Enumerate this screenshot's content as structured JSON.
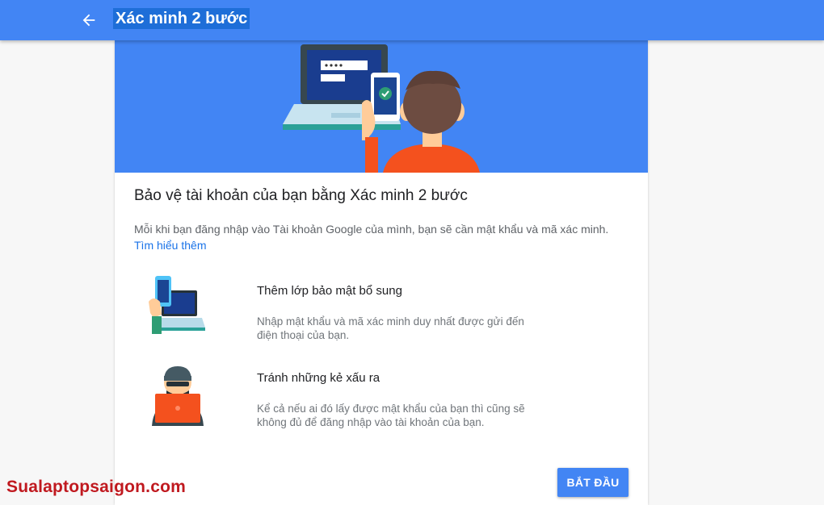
{
  "header": {
    "title": "Xác minh 2 bước",
    "back_icon": "arrow-back-icon"
  },
  "card": {
    "heading": "Bảo vệ tài khoản của bạn bằng Xác minh 2 bước",
    "intro": "Mỗi khi bạn đăng nhập vào Tài khoản Google của mình, bạn sẽ cần mật khẩu và mã xác minh.",
    "learn_more": "Tìm hiểu thêm",
    "features": [
      {
        "title": "Thêm lớp bảo mật bổ sung",
        "description": "Nhập mật khẩu và mã xác minh duy nhất được gửi đến điện thoại của bạn.",
        "icon": "phone-laptop-icon"
      },
      {
        "title": "Tránh những kẻ xấu ra",
        "description": "Kể cả nếu ai đó lấy được mật khẩu của bạn thì cũng sẽ không đủ để đăng nhập vào tài khoản của bạn.",
        "icon": "hacker-icon"
      }
    ],
    "start_button": "BẮT ĐẦU"
  },
  "watermark": "Sualaptopsaigon.com",
  "colors": {
    "primary": "#4285f4",
    "link": "#1a73e8",
    "watermark": "#c0191f"
  }
}
